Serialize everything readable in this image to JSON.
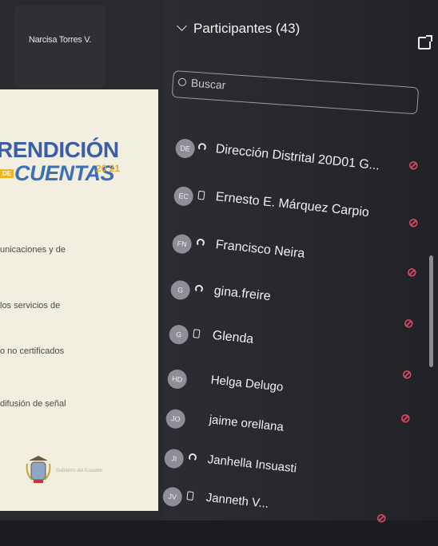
{
  "video": {
    "participant_name": "Narcisa Torres V."
  },
  "slide": {
    "title_line1": "RENDICIÓN",
    "title_prefix": "DE",
    "title_line2": "CUENTAS",
    "year": "20 21",
    "lines": [
      "unicaciones y de",
      "los servicios de",
      "o no certificados",
      "difusión de señal"
    ],
    "crest_text": "Gobierno del Ecuador"
  },
  "panel": {
    "title": "Participantes (43)",
    "search_placeholder": "Buscar"
  },
  "participants": [
    {
      "initials": "DE",
      "name": "Dirección Distrital 20D01 G...",
      "device": "headset",
      "muted": true
    },
    {
      "initials": "EC",
      "name": "Ernesto E. Márquez Carpio",
      "device": "phone",
      "muted": true
    },
    {
      "initials": "FN",
      "name": "Francisco Neira",
      "device": "headset",
      "muted": true
    },
    {
      "initials": "G",
      "name": "gina.freire",
      "device": "headset",
      "muted": true
    },
    {
      "initials": "G",
      "name": "Glenda",
      "device": "phone",
      "muted": true
    },
    {
      "initials": "HD",
      "name": "Helga Delugo",
      "device": "none",
      "muted": true
    },
    {
      "initials": "JO",
      "name": "jaime orellana",
      "device": "none",
      "muted": false
    },
    {
      "initials": "JI",
      "name": "Janhella Insuasti",
      "device": "headset",
      "muted": false
    },
    {
      "initials": "JV",
      "name": "Janneth V...",
      "device": "phone",
      "muted": true
    }
  ],
  "icons": {
    "collapse": "chevron-down-icon",
    "popout": "popout-icon",
    "search": "search-icon",
    "headset": "headset-icon",
    "phone": "phone-icon",
    "muted": "mic-muted-icon"
  },
  "colors": {
    "muted_mic": "#e0455a",
    "panel_bg": "#2b2d33",
    "slide_blue": "#3b5ea6"
  }
}
